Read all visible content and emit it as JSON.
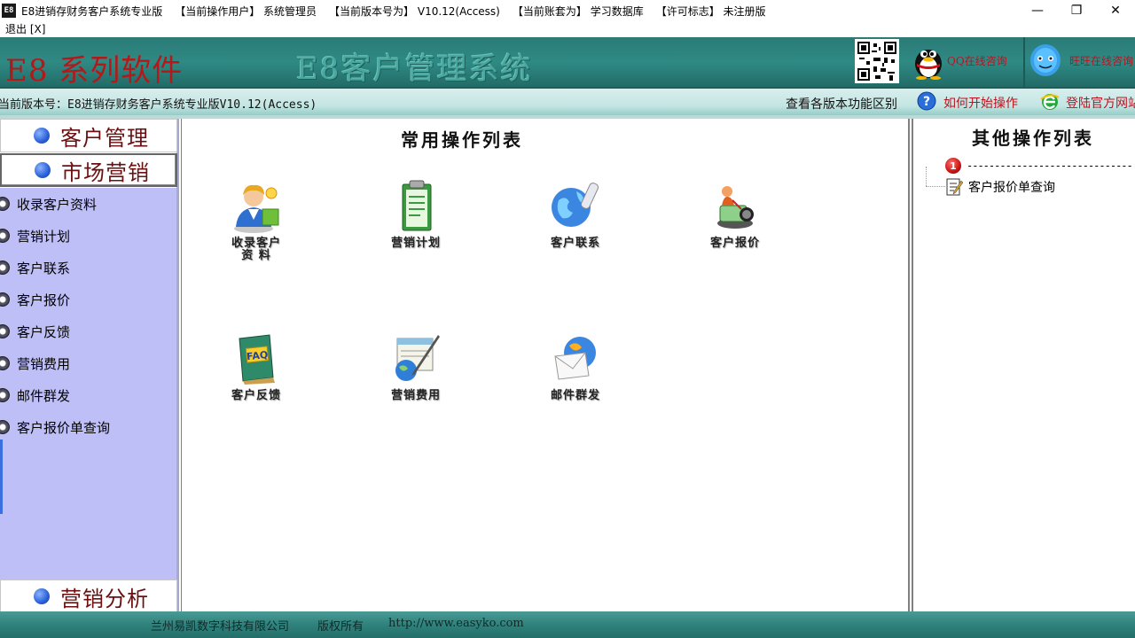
{
  "window": {
    "app_icon_label": "E8",
    "title": "E8进销存财务客户系统专业版",
    "current_user": "【当前操作用户】 系统管理员",
    "current_version": "【当前版本号为】 V10.12(Access)",
    "current_account": "【当前账套为】 学习数据库",
    "license": "【许可标志】 未注册版",
    "minimize": "—",
    "restore": "❐",
    "close": "✕"
  },
  "menu": {
    "exit_label": "退出 [X]"
  },
  "banner": {
    "brand": "E8 系列软件",
    "system_title": "E8客户管理系统",
    "qq_label": "QQ在线咨询",
    "wangwang_label": "旺旺在线咨询"
  },
  "version_bar": {
    "version_text": "当前版本号：E8进销存财务客户系统专业版V10.12(Access)",
    "compare_label": "查看各版本功能区别",
    "help_label": "如何开始操作",
    "login_label": "登陆官方网站"
  },
  "sidebar": {
    "sections": [
      {
        "label": "客户管理"
      },
      {
        "label": "市场营销"
      },
      {
        "label": "营销分析"
      }
    ],
    "items": [
      {
        "label": "收录客户资料"
      },
      {
        "label": "营销计划"
      },
      {
        "label": "客户联系"
      },
      {
        "label": "客户报价"
      },
      {
        "label": "客户反馈"
      },
      {
        "label": "营销费用"
      },
      {
        "label": "邮件群发"
      },
      {
        "label": "客户报价单查询"
      }
    ]
  },
  "main": {
    "title": "常用操作列表",
    "operations": [
      {
        "line1": "收录客户",
        "line2": "资   料",
        "icon": "customer-info-icon"
      },
      {
        "line1": "营销计划",
        "line2": "",
        "icon": "marketing-plan-icon"
      },
      {
        "line1": "客户联系",
        "line2": "",
        "icon": "customer-contact-icon"
      },
      {
        "line1": "客户报价",
        "line2": "",
        "icon": "customer-quote-icon"
      },
      {
        "line1": "客户反馈",
        "line2": "",
        "icon": "faq-book-icon"
      },
      {
        "line1": "营销费用",
        "line2": "",
        "icon": "marketing-expense-icon"
      },
      {
        "line1": "邮件群发",
        "line2": "",
        "icon": "mail-icon"
      }
    ]
  },
  "right_panel": {
    "title": "其他操作列表",
    "tree_root_number": "1",
    "tree_root_text": "------------------------------",
    "tree_child": "客户报价单查询"
  },
  "footer": {
    "company": "兰州易凯数字科技有限公司",
    "rights": "版权所有",
    "url": "http://www.easyko.com"
  },
  "colors": {
    "banner_teal": "#2f8a84",
    "brand_red": "#b51818",
    "sidebar_lavender": "#bfbff8",
    "link_red": "#c0101e"
  }
}
